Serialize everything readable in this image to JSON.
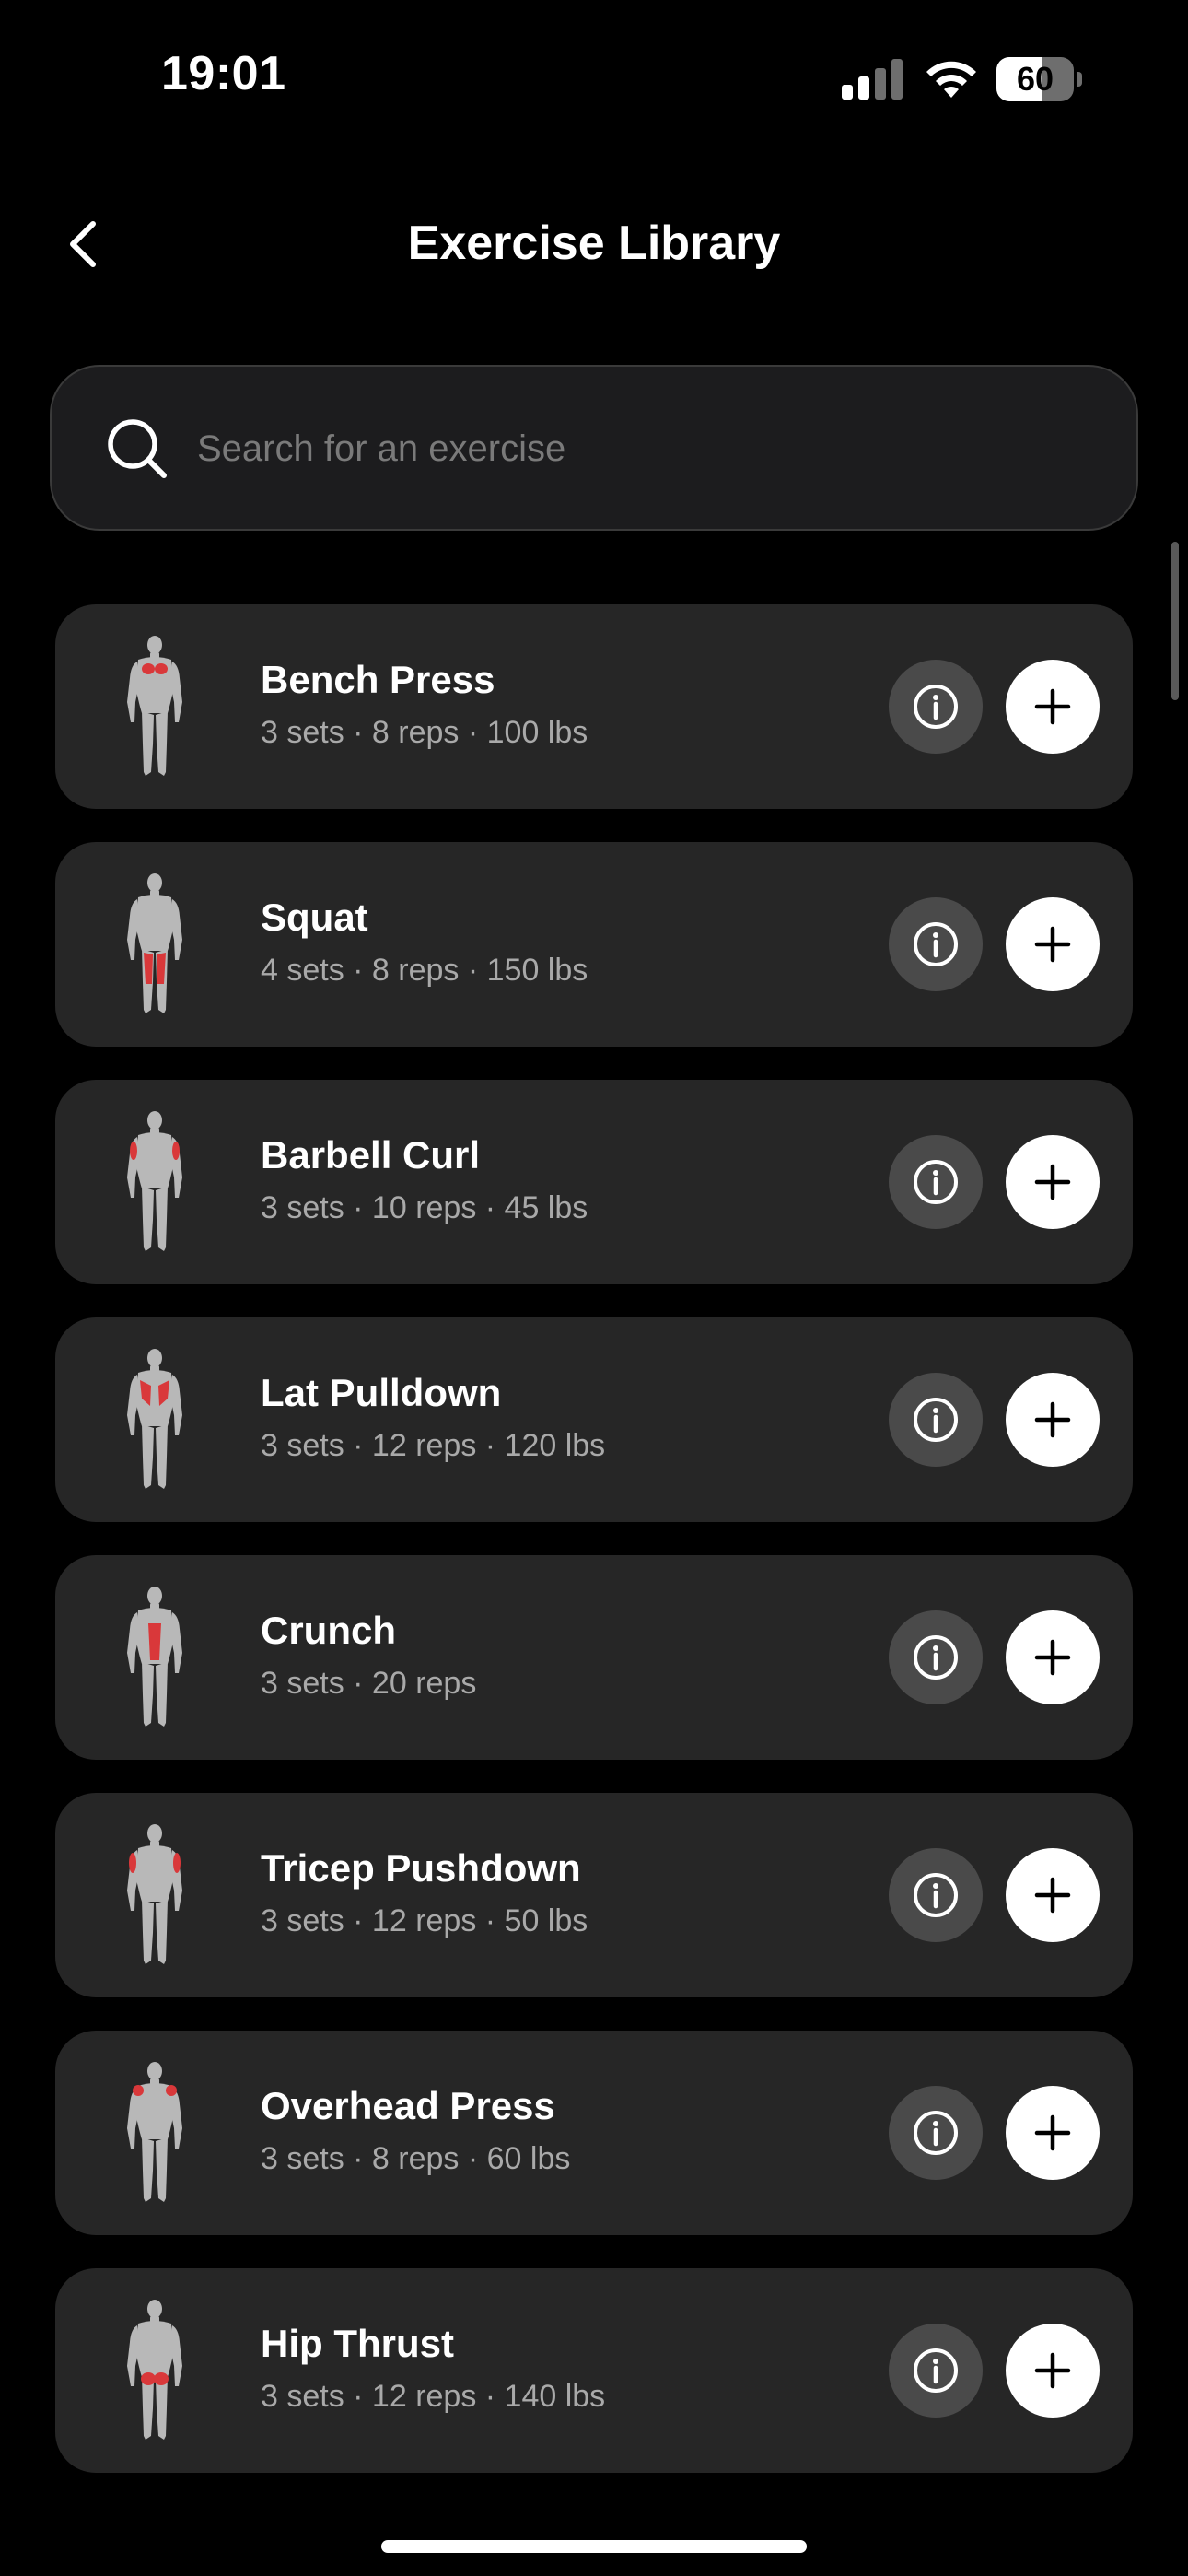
{
  "status_bar": {
    "time": "19:01",
    "battery_level": "60",
    "battery_fraction": 0.6
  },
  "header": {
    "title": "Exercise Library",
    "back_icon": "chevron-left-icon"
  },
  "search": {
    "placeholder": "Search for an exercise",
    "value": "",
    "icon": "search-icon"
  },
  "colors": {
    "background": "#000000",
    "card": "#262626",
    "muscle_highlight": "#d9383a",
    "body_base": "#b8b8b8",
    "info_button": "#4a4a4a",
    "add_button": "#ffffff"
  },
  "exercises": [
    {
      "name": "Bench Press",
      "detail": "3 sets · 8 reps · 100 lbs",
      "muscle": "chest"
    },
    {
      "name": "Squat",
      "detail": "4 sets · 8 reps · 150 lbs",
      "muscle": "quads"
    },
    {
      "name": "Barbell Curl",
      "detail": "3 sets · 10 reps · 45 lbs",
      "muscle": "biceps"
    },
    {
      "name": "Lat Pulldown",
      "detail": "3 sets · 12 reps · 120 lbs",
      "muscle": "lats"
    },
    {
      "name": "Crunch",
      "detail": "3 sets · 20 reps",
      "muscle": "abs"
    },
    {
      "name": "Tricep Pushdown",
      "detail": "3 sets · 12 reps · 50 lbs",
      "muscle": "triceps"
    },
    {
      "name": "Overhead Press",
      "detail": "3 sets · 8 reps · 60 lbs",
      "muscle": "shoulders"
    },
    {
      "name": "Hip Thrust",
      "detail": "3 sets · 12 reps · 140 lbs",
      "muscle": "glutes"
    }
  ]
}
